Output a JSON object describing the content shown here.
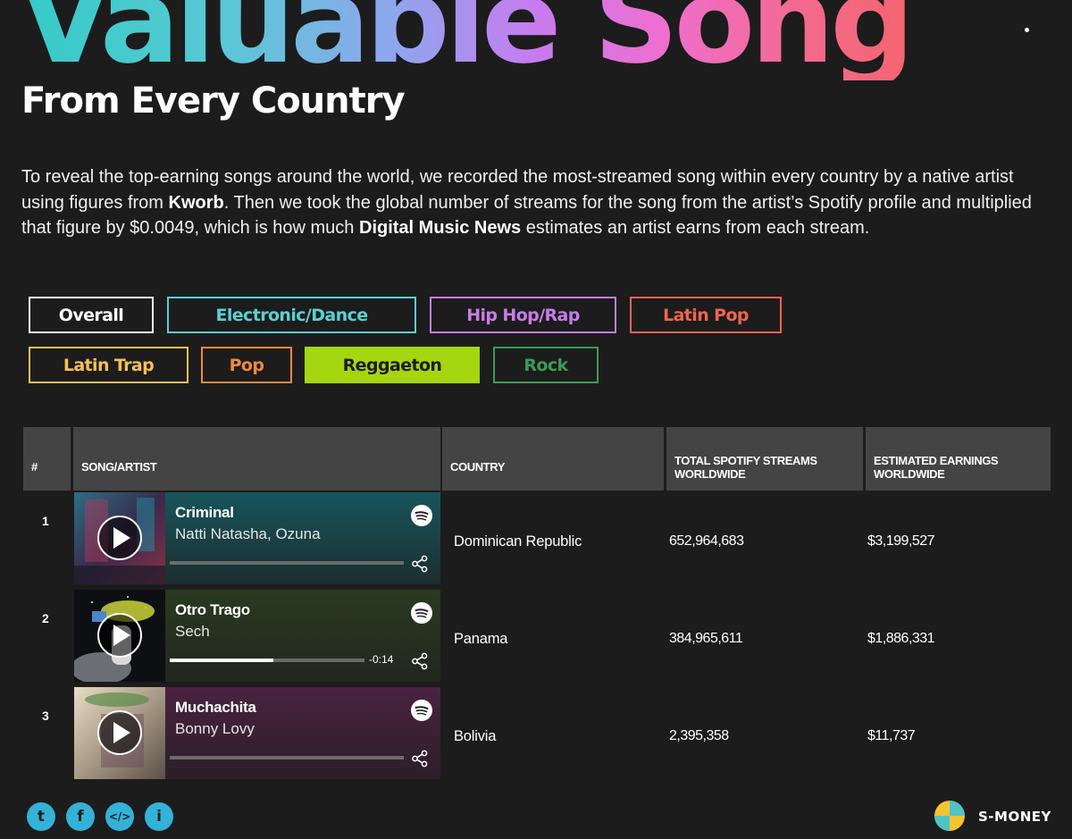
{
  "header": {
    "title": "Valuable Song",
    "subtitle": "From Every Country"
  },
  "intro": {
    "part1": "To reveal the top-earning songs around the world, we recorded the most-streamed song within every country by a native artist using figures from ",
    "source1": "Kworb",
    "part2": ". Then we took the global number of streams for the song from the artist’s Spotify profile and multiplied that figure by $0.0049, which is how much ",
    "source2": "Digital Music News",
    "part3": " estimates an artist earns from each stream."
  },
  "filters": [
    {
      "label": "Overall",
      "color": "#ffffff",
      "selected": false
    },
    {
      "label": "Electronic/Dance",
      "color": "#5ccfd0",
      "selected": false
    },
    {
      "label": "Hip Hop/Rap",
      "color": "#c77de8",
      "selected": false
    },
    {
      "label": "Latin Pop",
      "color": "#f26350",
      "selected": false
    },
    {
      "label": "Latin Trap",
      "color": "#f3c152",
      "selected": false
    },
    {
      "label": "Pop",
      "color": "#f08a3c",
      "selected": false
    },
    {
      "label": "Reggaeton",
      "color": "#a6d60f",
      "selected": true
    },
    {
      "label": "Rock",
      "color": "#3c9b57",
      "selected": false
    }
  ],
  "table": {
    "headers": {
      "rank": "#",
      "song": "SONG/ARTIST",
      "country": "COUNTRY",
      "streams": "TOTAL SPOTIFY STREAMS WORLDWIDE",
      "earnings": "ESTIMATED EARNINGS WORLDWIDE"
    },
    "rows": [
      {
        "rank": "1",
        "title": "Criminal",
        "artist": "Natti Natasha, Ozuna",
        "country": "Dominican Republic",
        "streams": "652,964,683",
        "earnings": "$3,199,527",
        "player_color": "#17555c",
        "time": "",
        "progress": 0
      },
      {
        "rank": "2",
        "title": "Otro Trago",
        "artist": "Sech",
        "country": "Panama",
        "streams": "384,965,611",
        "earnings": "$1,886,331",
        "player_color": "#2a3a20",
        "time": "-0:14",
        "progress": 0.53
      },
      {
        "rank": "3",
        "title": "Muchachita",
        "artist": "Bonny Lovy",
        "country": "Bolivia",
        "streams": "2,395,358",
        "earnings": "$11,737",
        "player_color": "#4a2240",
        "time": "",
        "progress": 0
      }
    ]
  },
  "social": [
    {
      "icon": "twitter-icon",
      "glyph": "t"
    },
    {
      "icon": "facebook-icon",
      "glyph": "f"
    },
    {
      "icon": "embed-icon",
      "glyph": "</>"
    },
    {
      "icon": "info-icon",
      "glyph": "i"
    }
  ],
  "brand": {
    "name": "S-MONEY"
  }
}
